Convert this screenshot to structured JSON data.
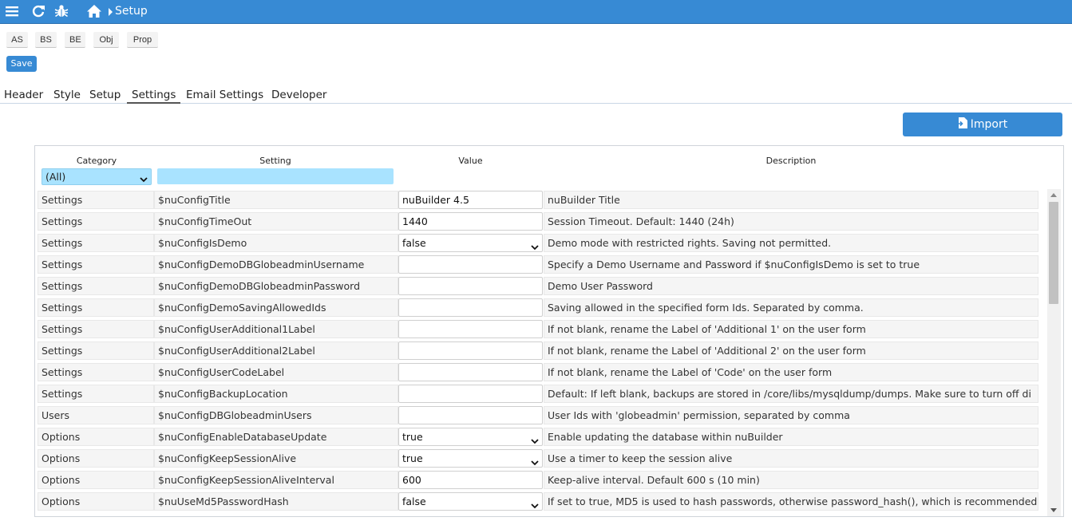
{
  "topbar": {
    "breadcrumb": "Setup",
    "icons": [
      "menu-icon",
      "refresh-icon",
      "bug-icon",
      "home-icon"
    ]
  },
  "toolbar": {
    "buttons": [
      "AS",
      "BS",
      "BE",
      "Obj",
      "Prop"
    ],
    "save_label": "Save"
  },
  "tabs": [
    "Header",
    "Style",
    "Setup",
    "Settings",
    "Email Settings",
    "Developer"
  ],
  "active_tab": "Settings",
  "import_label": "Import",
  "table": {
    "headers": {
      "category": "Category",
      "setting": "Setting",
      "value": "Value",
      "description": "Description"
    },
    "category_filter": "(All)",
    "setting_filter": "",
    "rows": [
      {
        "category": "Settings",
        "setting": "$nuConfigTitle",
        "value": "nuBuilder 4.5",
        "type": "text",
        "description": "nuBuilder Title"
      },
      {
        "category": "Settings",
        "setting": "$nuConfigTimeOut",
        "value": "1440",
        "type": "text",
        "description": "Session Timeout. Default: 1440 (24h)"
      },
      {
        "category": "Settings",
        "setting": "$nuConfigIsDemo",
        "value": "false",
        "type": "select",
        "description": "Demo mode with restricted rights. Saving not permitted."
      },
      {
        "category": "Settings",
        "setting": "$nuConfigDemoDBGlobeadminUsername",
        "value": "",
        "type": "text",
        "description": "Specify a Demo Username and Password if $nuConfigIsDemo is set to true"
      },
      {
        "category": "Settings",
        "setting": "$nuConfigDemoDBGlobeadminPassword",
        "value": "",
        "type": "text",
        "description": "Demo User Password"
      },
      {
        "category": "Settings",
        "setting": "$nuConfigDemoSavingAllowedIds",
        "value": "",
        "type": "text",
        "description": "Saving allowed in the specified form Ids. Separated by comma."
      },
      {
        "category": "Settings",
        "setting": "$nuConfigUserAdditional1Label",
        "value": "",
        "type": "text",
        "description": "If not blank, rename the Label of 'Additional 1' on the user form"
      },
      {
        "category": "Settings",
        "setting": "$nuConfigUserAdditional2Label",
        "value": "",
        "type": "text",
        "description": "If not blank, rename the Label of 'Additional 2' on the user form"
      },
      {
        "category": "Settings",
        "setting": "$nuConfigUserCodeLabel",
        "value": "",
        "type": "text",
        "description": "If not blank, rename the Label of 'Code' on the user form"
      },
      {
        "category": "Settings",
        "setting": "$nuConfigBackupLocation",
        "value": "",
        "type": "text",
        "description": "Default: If left blank, backups are stored in /core/libs/mysqldump/dumps. Make sure to turn off di"
      },
      {
        "category": "Users",
        "setting": "$nuConfigDBGlobeadminUsers",
        "value": "",
        "type": "text",
        "description": "User Ids with 'globeadmin' permission, separated by comma"
      },
      {
        "category": "Options",
        "setting": "$nuConfigEnableDatabaseUpdate",
        "value": "true",
        "type": "select",
        "description": "Enable updating the database within nuBuilder"
      },
      {
        "category": "Options",
        "setting": "$nuConfigKeepSessionAlive",
        "value": "true",
        "type": "select",
        "description": "Use a timer to keep the session alive"
      },
      {
        "category": "Options",
        "setting": "$nuConfigKeepSessionAliveInterval",
        "value": "600",
        "type": "text",
        "description": "Keep-alive interval. Default 600 s (10 min)"
      },
      {
        "category": "Options",
        "setting": "$nuUseMd5PasswordHash",
        "value": "false",
        "type": "select",
        "description": "If set to true, MD5 is used to hash passwords, otherwise password_hash(), which is recommended."
      }
    ]
  }
}
